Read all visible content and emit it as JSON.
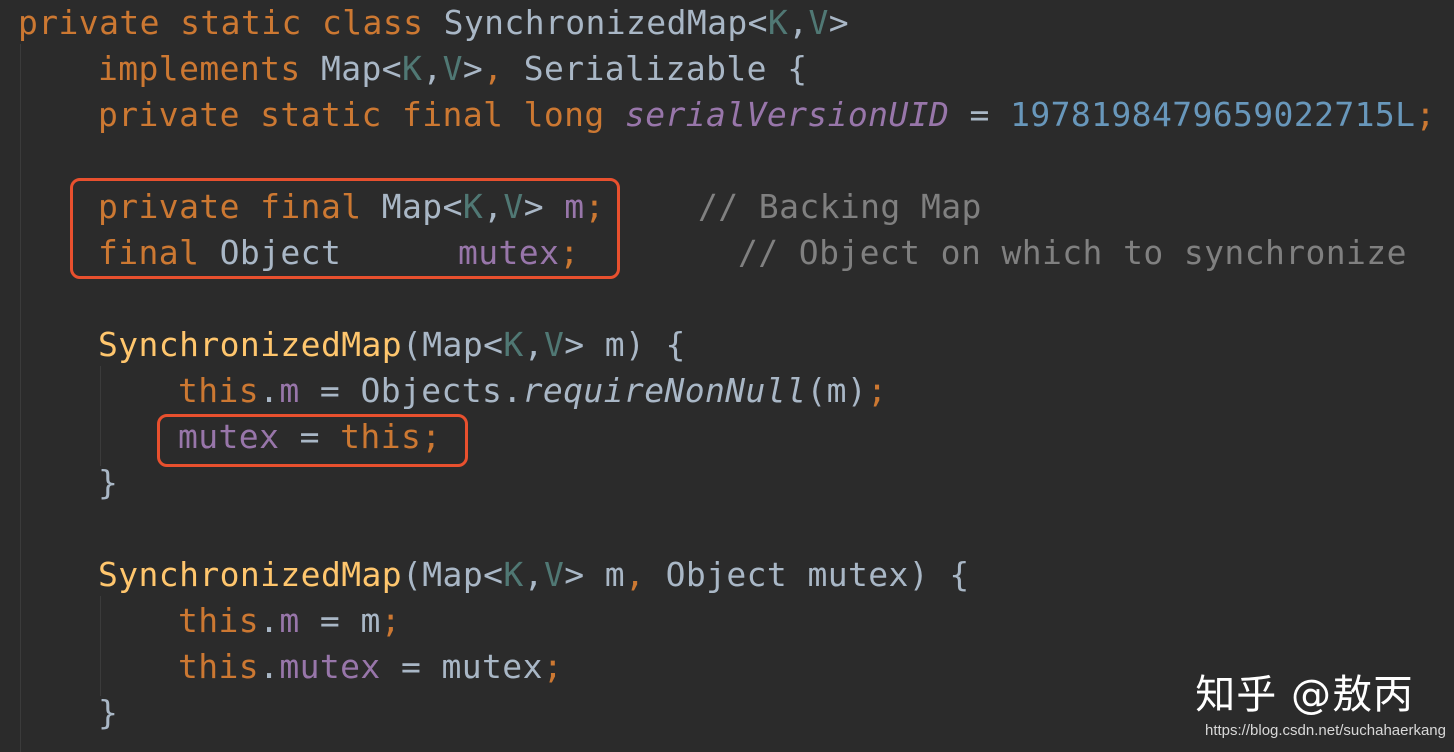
{
  "code": {
    "l1": {
      "kw": "private static class ",
      "name": "SynchronizedMap",
      "lt": "<",
      "k": "K",
      "comma": ",",
      "v": "V",
      "gt": ">"
    },
    "l2": {
      "kw": "implements ",
      "map": "Map",
      "lt": "<",
      "k": "K",
      "comma": ",",
      "v": "V",
      "gt": ">",
      "sep": ", ",
      "ser": "Serializable {"
    },
    "l3": {
      "kw": "private static final long ",
      "field": "serialVersionUID",
      "eq": " = ",
      "num": "1978198479659022715L",
      "semi": ";"
    },
    "l4": {
      "kw": "private final ",
      "map": "Map",
      "lt": "<",
      "k": "K",
      "comma": ",",
      "v": "V",
      "gt": "> ",
      "field": "m",
      "semi": ";",
      "comment": "// Backing Map"
    },
    "l5": {
      "kw": "final ",
      "obj": "Object",
      "field": "mutex",
      "semi": ";",
      "comment": "// Object on which to synchronize"
    },
    "l6": {
      "name": "SynchronizedMap",
      "open": "(Map",
      "lt": "<",
      "k": "K",
      "comma": ",",
      "v": "V",
      "rest": "> m) {"
    },
    "l7": {
      "this": "this",
      "dot": ".",
      "field": "m",
      "eq": " = Objects.",
      "call": "requireNonNull",
      "args": "(m)",
      "semi": ";"
    },
    "l8": {
      "field": "mutex",
      "eq": " = ",
      "this": "this",
      "semi": ";"
    },
    "l9": {
      "brace": "}"
    },
    "l10": {
      "name": "SynchronizedMap",
      "open": "(Map",
      "lt": "<",
      "k": "K",
      "comma": ",",
      "v": "V",
      "mid": "> m",
      "comma2": ",",
      "rest": " Object mutex) {"
    },
    "l11": {
      "this": "this",
      "dot": ".",
      "field": "m",
      "eq": " = m",
      "semi": ";"
    },
    "l12": {
      "this": "this",
      "dot": ".",
      "field": "mutex",
      "eq": " = mutex",
      "semi": ";"
    },
    "l13": {
      "brace": "}"
    }
  },
  "watermark": {
    "zhihu": "知乎 @敖丙",
    "url": "https://blog.csdn.net/suchahaerkang"
  },
  "colors": {
    "background": "#2b2b2b",
    "keyword": "#cc7832",
    "field": "#9876aa",
    "number": "#6897bb",
    "method_decl": "#ffc66d",
    "type_param": "#507874",
    "comment": "#808080",
    "text": "#a9b7c6",
    "highlight_box": "#e8502e"
  }
}
